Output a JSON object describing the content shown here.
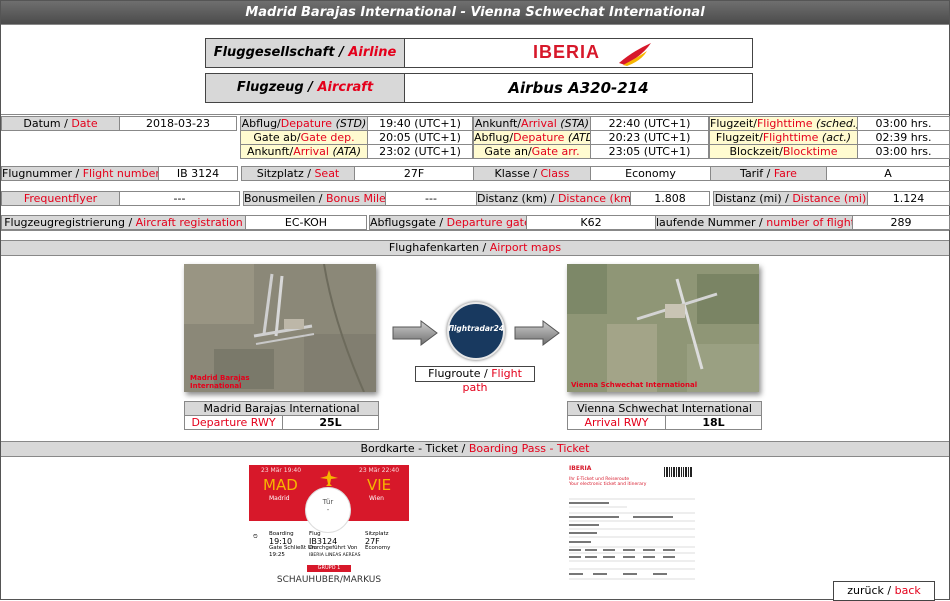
{
  "title": "Madrid Barajas International - Vienna Schwechat International",
  "header": {
    "airline_label_de": "Fluggesellschaft",
    "airline_label_en": "Airline",
    "airline_logo_text": "IBERIA",
    "aircraft_label_de": "Flugzeug",
    "aircraft_label_en": "Aircraft",
    "aircraft_value": "Airbus A320-214"
  },
  "row1": {
    "date_de": "Datum",
    "date_en": "Date",
    "date_value": "2018-03-23",
    "dep_de": "Abflug/",
    "dep_en": "Depature",
    "dep_suffix": "(STD)",
    "dep_value": "19:40 (UTC+1)",
    "arr_de": "Ankunft/",
    "arr_en": "Arrival",
    "arr_suffix": "(STA)",
    "arr_value": "22:40 (UTC+1)",
    "ft_de": "Flugzeit/",
    "ft_en": "Flighttime",
    "ft_suffix": "(sched.)",
    "ft_value": "03:00 hrs."
  },
  "row2": {
    "gate_de": "Gate ab/",
    "gate_en": "Gate dep.",
    "gate_value": "20:05 (UTC+1)",
    "atd_de": "Abflug/",
    "atd_en": "Depature",
    "atd_suffix": "(ATD)",
    "atd_value": "20:23 (UTC+1)",
    "fta_de": "Flugzeit/",
    "fta_en": "Flighttime",
    "fta_suffix": "(act.)",
    "fta_value": "02:39 hrs."
  },
  "row3": {
    "ata_de": "Ankunft/",
    "ata_en": "Arrival",
    "ata_suffix": "(ATA)",
    "ata_value": "23:02 (UTC+1)",
    "garr_de": "Gate an/",
    "garr_en": "Gate arr.",
    "garr_value": "23:05 (UTC+1)",
    "block_de": "Blockzeit/",
    "block_en": "Blocktime",
    "block_value": "03:00 hrs."
  },
  "row4": {
    "fn_de": "Flugnummer /",
    "fn_en": "Flight number",
    "fn_value": "IB 3124",
    "seat_de": "Sitzplatz /",
    "seat_en": "Seat",
    "seat_value": "27F",
    "class_de": "Klasse /",
    "class_en": "Class",
    "class_value": "Economy",
    "fare_de": "Tarif /",
    "fare_en": "Fare",
    "fare_value": "A"
  },
  "row5": {
    "ff_en": "Frequentflyer",
    "ff_value": "---",
    "bm_de": "Bonusmeilen /",
    "bm_en": "Bonus Miles",
    "bm_value": "---",
    "dkm_de": "Distanz (km) /",
    "dkm_en": "Distance (km)",
    "dkm_value": "1.808",
    "dmi_de": "Distanz (mi) /",
    "dmi_en": "Distance (mi)",
    "dmi_value": "1.124"
  },
  "row6": {
    "reg_de": "Flugzeugregistrierung /",
    "reg_en": "Aircraft registration",
    "reg_value": "EC-KOH",
    "dg_de": "Abflugsgate /",
    "dg_en": "Departure gate",
    "dg_value": "K62",
    "nr_de": "laufende Nummer /",
    "nr_en": "number of flights",
    "nr_value": "289"
  },
  "maps": {
    "section_de": "Flughafenkarten /",
    "section_en": "Airport maps",
    "dep_map_caption": "Madrid Barajas International",
    "arr_map_caption": "Vienna Schwechat International",
    "dep_name": "Madrid Barajas International",
    "dep_rwy_label": "Departure RWY",
    "dep_rwy_value": "25L",
    "arr_name": "Vienna Schwechat International",
    "arr_rwy_label": "Arrival RWY",
    "arr_rwy_value": "18L",
    "fr24_text": "flightradar24",
    "path_de": "Flugroute /",
    "path_en": "Flight path"
  },
  "boarding": {
    "section_de": "Bordkarte - Ticket /",
    "section_en": "Boarding Pass - Ticket",
    "bp_dep_time": "23 Mär 19:40",
    "bp_arr_time": "23 Mär 22:40",
    "bp_from": "MAD",
    "bp_to": "VIE",
    "bp_from_city": "Madrid",
    "bp_to_city": "Wien",
    "bp_door": "Tür",
    "bp_door_value": "-",
    "bp_boarding": "Boarding",
    "bp_boarding_time": "19:10",
    "bp_gate_close": "Gate Schließt Um",
    "bp_gate_close_time": "19:25",
    "bp_flight": "Flug",
    "bp_flight_value": "IB3124",
    "bp_operated": "Durchgeführt Von",
    "bp_operator": "IBERIA LINEAS AEREAS",
    "bp_seat": "Sitzplatz",
    "bp_seat_value": "27F",
    "bp_class": "Economy",
    "bp_group": "GRUPO 1",
    "bp_passenger": "SCHAUHUBER/MARKUS",
    "ticket_logo": "IBERIA",
    "ticket_line1": "Ihr E-Ticket und Reiseroute",
    "ticket_line2": "Your electronic ticket and itinerary"
  },
  "nav": {
    "back_de": "zurück /",
    "back_en": "back"
  },
  "colors": {
    "accent": "#e4001b",
    "titlebar": "#5a5a5a",
    "label_bg": "#d8d8d8",
    "highlight_bg": "#fffbd0"
  }
}
